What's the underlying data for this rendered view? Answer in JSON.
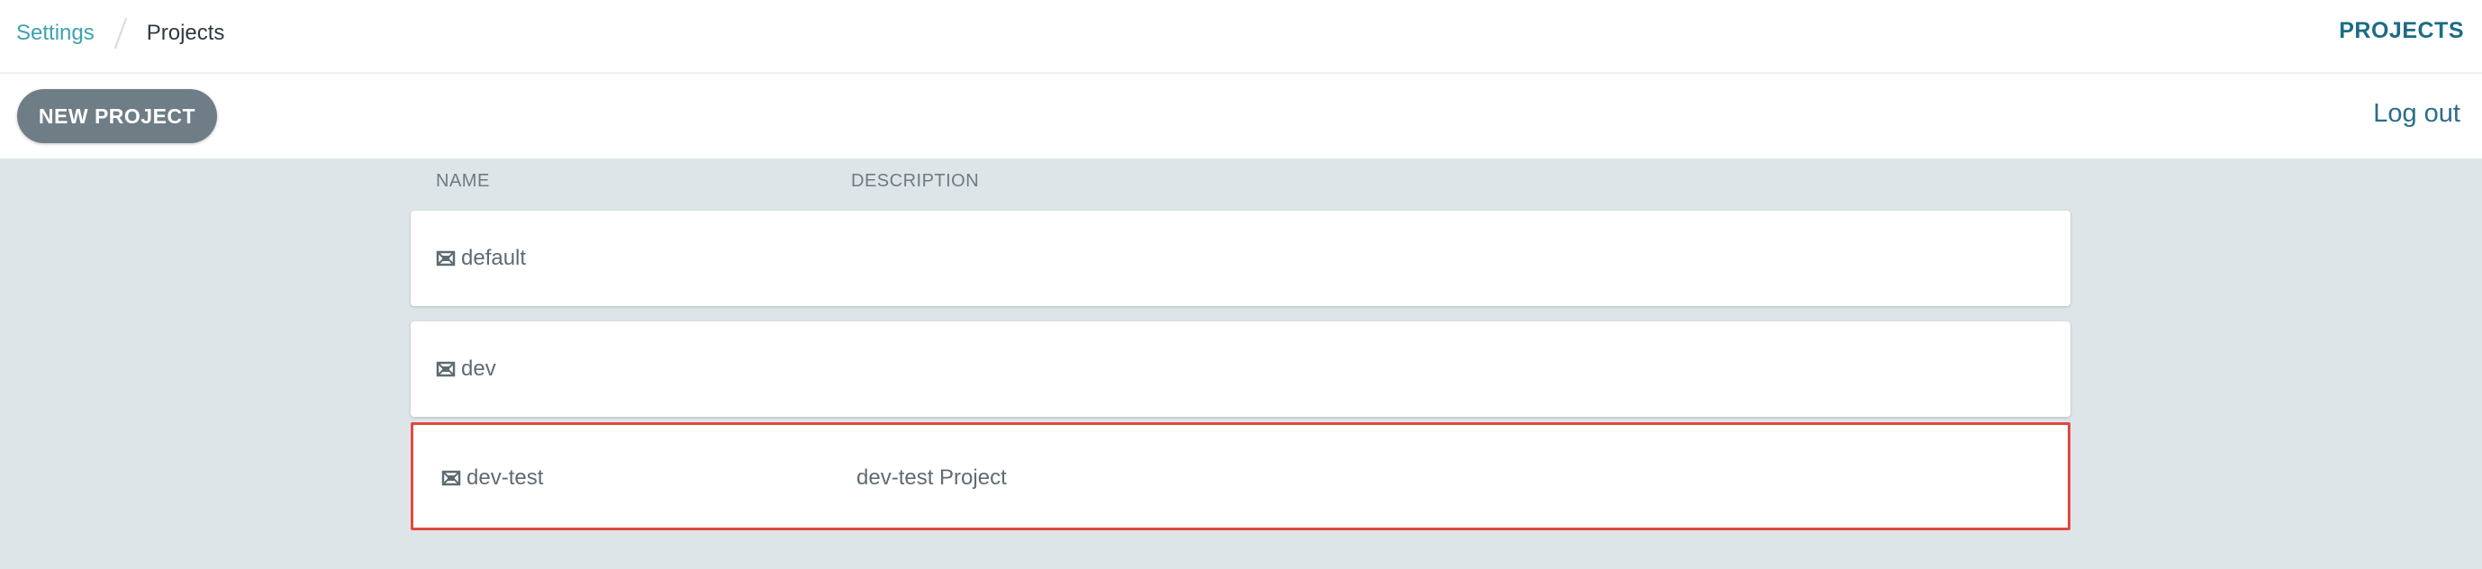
{
  "breadcrumb": {
    "parent": "Settings",
    "current": "Projects"
  },
  "header": {
    "title": "PROJECTS"
  },
  "toolbar": {
    "new_project_label": "NEW PROJECT",
    "logout_label": "Log out"
  },
  "table": {
    "columns": [
      "NAME",
      "DESCRIPTION"
    ],
    "rows": [
      {
        "icon": "project-icon",
        "name": "default",
        "description": ""
      },
      {
        "icon": "project-icon",
        "name": "dev",
        "description": ""
      },
      {
        "icon": "project-icon",
        "name": "dev-test",
        "description": "dev-test Project",
        "highlighted": true
      }
    ]
  },
  "colors": {
    "accent": "#1c6c86",
    "link": "#3ba3ad",
    "button": "#6f7d87",
    "background": "#dee5e8",
    "highlight_border": "#e04a3f"
  }
}
